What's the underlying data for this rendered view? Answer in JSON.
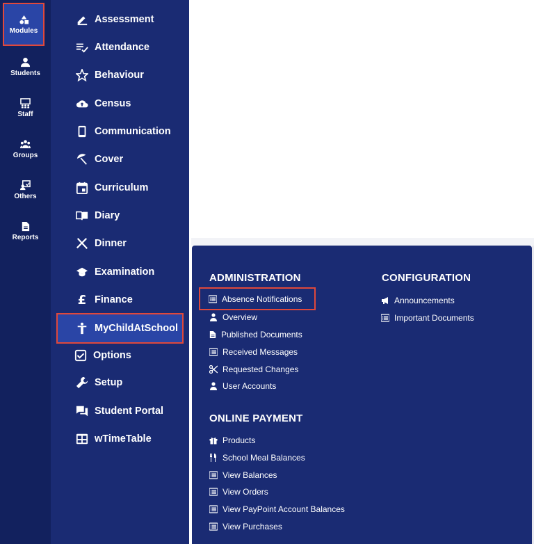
{
  "rail": {
    "items": [
      {
        "label": "Modules",
        "icon": "shapes-icon"
      },
      {
        "label": "Students",
        "icon": "person-icon"
      },
      {
        "label": "Staff",
        "icon": "staff-icon"
      },
      {
        "label": "Groups",
        "icon": "groups-icon"
      },
      {
        "label": "Others",
        "icon": "others-icon"
      },
      {
        "label": "Reports",
        "icon": "document-icon"
      }
    ]
  },
  "modules": {
    "items": [
      {
        "label": "Assessment",
        "icon": "pencil-icon"
      },
      {
        "label": "Attendance",
        "icon": "list-check-icon"
      },
      {
        "label": "Behaviour",
        "icon": "star-icon"
      },
      {
        "label": "Census",
        "icon": "cloud-upload-icon"
      },
      {
        "label": "Communication",
        "icon": "phone-icon"
      },
      {
        "label": "Cover",
        "icon": "umbrella-icon"
      },
      {
        "label": "Curriculum",
        "icon": "calendar-icon"
      },
      {
        "label": "Diary",
        "icon": "book-icon"
      },
      {
        "label": "Dinner",
        "icon": "cutlery-icon"
      },
      {
        "label": "Examination",
        "icon": "graduation-cap-icon"
      },
      {
        "label": "Finance",
        "icon": "pound-icon"
      },
      {
        "label": "MyChildAtSchool",
        "icon": "child-icon"
      },
      {
        "label": "Options",
        "icon": "checkbox-icon"
      },
      {
        "label": "Setup",
        "icon": "wrench-icon"
      },
      {
        "label": "Student Portal",
        "icon": "chat-icon"
      },
      {
        "label": "wTimeTable",
        "icon": "table-icon"
      }
    ]
  },
  "flyout": {
    "administration": {
      "title": "ADMINISTRATION",
      "items": [
        {
          "label": "Absence Notifications",
          "icon": "list-icon"
        },
        {
          "label": "Overview",
          "icon": "person-icon"
        },
        {
          "label": "Published Documents",
          "icon": "document-icon"
        },
        {
          "label": "Received Messages",
          "icon": "list-icon"
        },
        {
          "label": "Requested Changes",
          "icon": "scissors-icon"
        },
        {
          "label": "User Accounts",
          "icon": "person-icon"
        }
      ]
    },
    "configuration": {
      "title": "CONFIGURATION",
      "items": [
        {
          "label": "Announcements",
          "icon": "megaphone-icon"
        },
        {
          "label": "Important Documents",
          "icon": "list-icon"
        }
      ]
    },
    "online_payment": {
      "title": "ONLINE PAYMENT",
      "items": [
        {
          "label": "Products",
          "icon": "gift-icon"
        },
        {
          "label": "School Meal Balances",
          "icon": "cutlery-icon"
        },
        {
          "label": "View Balances",
          "icon": "list-icon"
        },
        {
          "label": "View Orders",
          "icon": "list-icon"
        },
        {
          "label": "View PayPoint Account Balances",
          "icon": "list-icon"
        },
        {
          "label": "View Purchases",
          "icon": "list-icon"
        }
      ]
    }
  },
  "colors": {
    "rail_bg": "#12215e",
    "panel_bg": "#1a2b73",
    "selected_bg": "#2a45a6",
    "highlight_border": "#e0483b"
  }
}
